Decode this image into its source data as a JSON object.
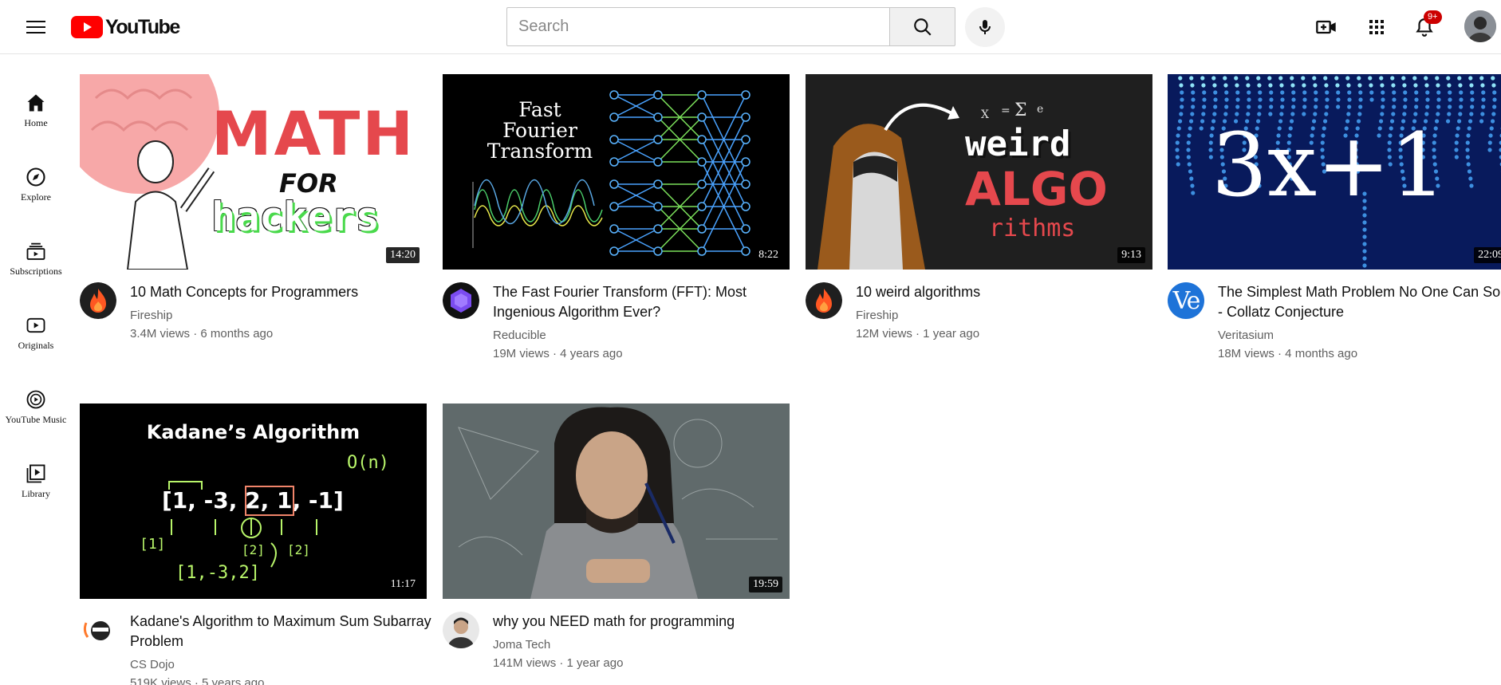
{
  "header": {
    "logo_text": "YouTube",
    "search_placeholder": "Search",
    "notification_badge": "9+"
  },
  "sidebar": {
    "items": [
      {
        "label": "Home",
        "icon": "home-icon"
      },
      {
        "label": "Explore",
        "icon": "compass-icon"
      },
      {
        "label": "Subscriptions",
        "icon": "subscriptions-icon"
      },
      {
        "label": "Originals",
        "icon": "originals-icon"
      },
      {
        "label": "YouTube Music",
        "icon": "music-icon"
      },
      {
        "label": "Library",
        "icon": "library-icon"
      }
    ]
  },
  "videos": [
    {
      "title": "10 Math Concepts for Programmers",
      "channel": "Fireship",
      "stats": "3.4M views · 6 months ago",
      "duration": "14:20",
      "thumb_text": [
        "MATH",
        "FOR",
        "hackers"
      ]
    },
    {
      "title": "The Fast Fourier Transform (FFT): Most Ingenious Algorithm Ever?",
      "channel": "Reducible",
      "stats": "19M views · 4 years ago",
      "duration": "8:22",
      "thumb_text": [
        "Fast",
        "Fourier",
        "Transform"
      ]
    },
    {
      "title": "10 weird algorithms",
      "channel": "Fireship",
      "stats": "12M views · 1 year ago",
      "duration": "9:13",
      "thumb_text": [
        "weird",
        "ALGO",
        "rithms"
      ]
    },
    {
      "title": "The Simplest Math Problem No One Can Solve - Collatz Conjecture",
      "channel": "Veritasium",
      "stats": "18M views · 4 months ago",
      "duration": "22:09",
      "thumb_text": [
        "3x+1"
      ],
      "channel_avatar_text": "Ve"
    },
    {
      "title": "Kadane's Algorithm to Maximum Sum Subarray Problem",
      "channel": "CS Dojo",
      "stats": "519K views · 5 years ago",
      "duration": "11:17",
      "thumb_text": [
        "Kadane’s Algorithm",
        "[1, -3, 2, 1, -1]",
        "O(n)",
        "[1]",
        "[2]",
        "[2]",
        "[1,-3,2]"
      ]
    },
    {
      "title": "why you NEED math for programming",
      "channel": "Joma Tech",
      "stats": "141M views · 1 year ago",
      "duration": "19:59",
      "thumb_text": []
    }
  ],
  "colors": {
    "brand_red": "#ff0000",
    "fireship_orange": "#ff5722",
    "text_primary": "#0f0f0f",
    "text_secondary": "#606060",
    "veritasium_blue": "#1e73d8"
  }
}
